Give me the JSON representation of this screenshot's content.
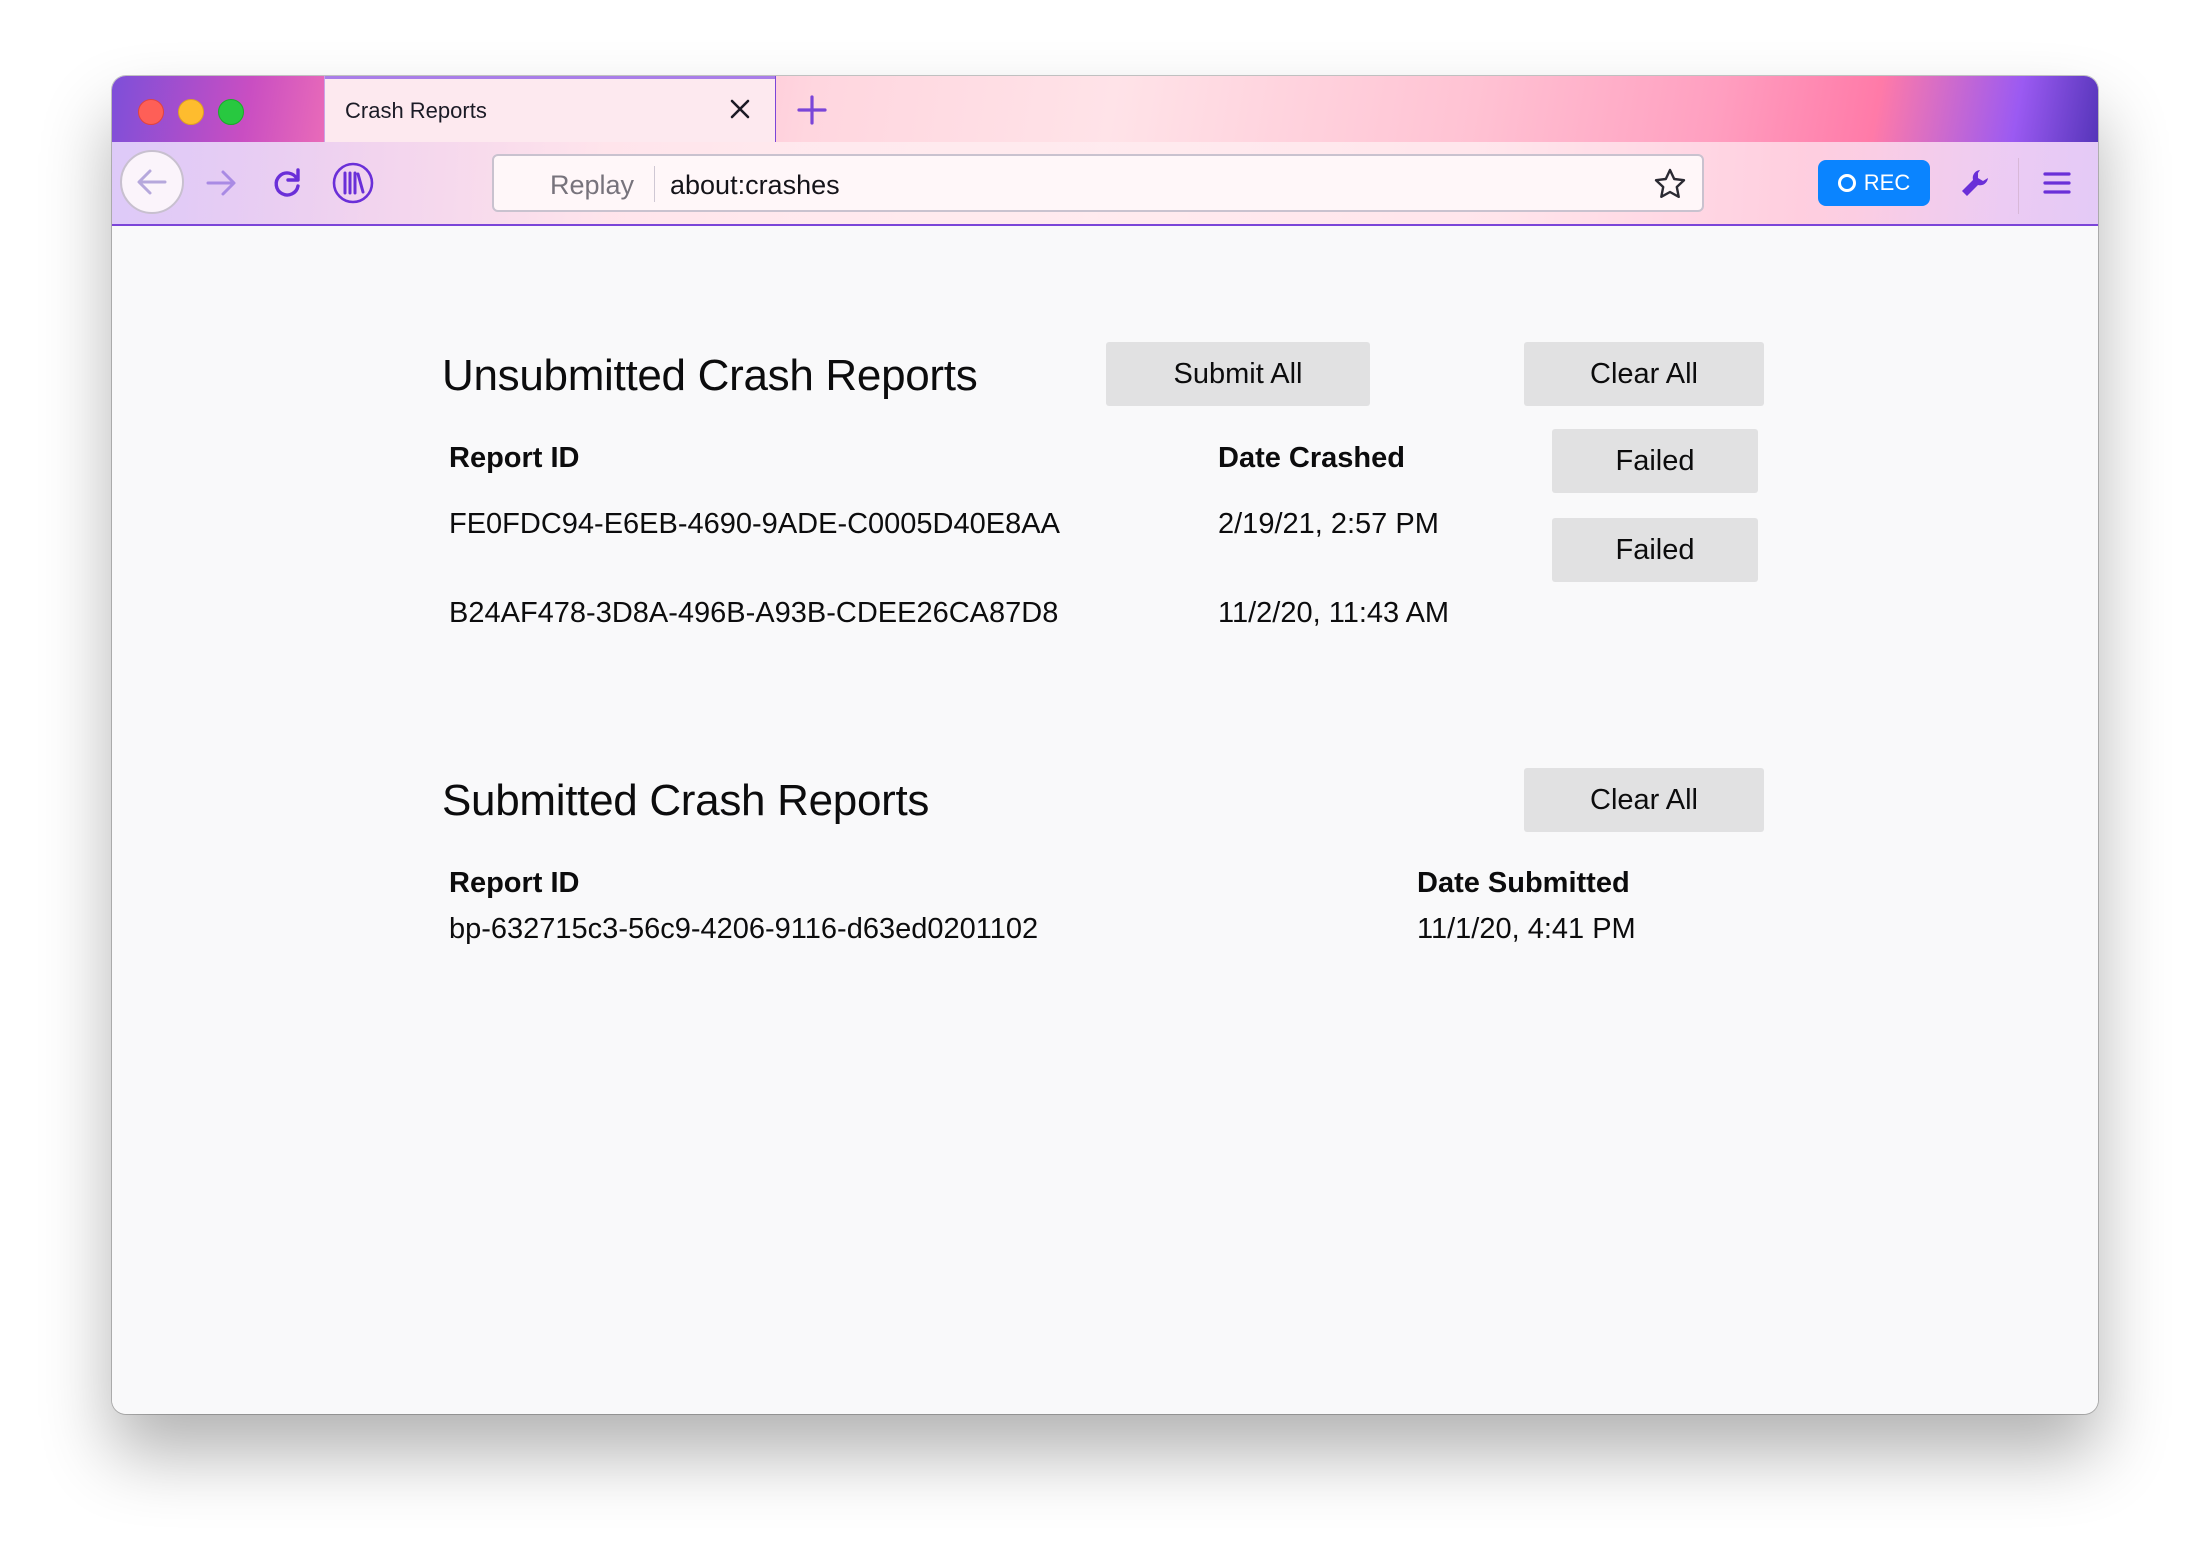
{
  "browser": {
    "tab_title": "Crash Reports",
    "url_prefix": "Replay",
    "url": "about:crashes",
    "rec_label": "REC"
  },
  "unsubmitted": {
    "title": "Unsubmitted Crash Reports",
    "submit_all_label": "Submit All",
    "clear_all_label": "Clear All",
    "col_report_id": "Report ID",
    "col_date": "Date Crashed",
    "rows": [
      {
        "id": "FE0FDC94-E6EB-4690-9ADE-C0005D40E8AA",
        "date": "2/19/21, 2:57 PM",
        "status": "Failed"
      },
      {
        "id": "B24AF478-3D8A-496B-A93B-CDEE26CA87D8",
        "date": "11/2/20, 11:43 AM",
        "status": "Failed"
      }
    ]
  },
  "submitted": {
    "title": "Submitted Crash Reports",
    "clear_all_label": "Clear All",
    "col_report_id": "Report ID",
    "col_date": "Date Submitted",
    "rows": [
      {
        "id": "bp-632715c3-56c9-4206-9116-d63ed0201102",
        "date": "11/1/20, 4:41 PM"
      }
    ]
  },
  "colors": {
    "accent": "#7b45d8",
    "rec": "#0a84ff",
    "button_bg": "#e1e1e2"
  },
  "icons": [
    "close-icon",
    "plus-icon",
    "back-arrow-icon",
    "forward-arrow-icon",
    "reload-icon",
    "library-icon",
    "star-icon",
    "record-icon",
    "wrench-icon",
    "hamburger-menu-icon"
  ]
}
